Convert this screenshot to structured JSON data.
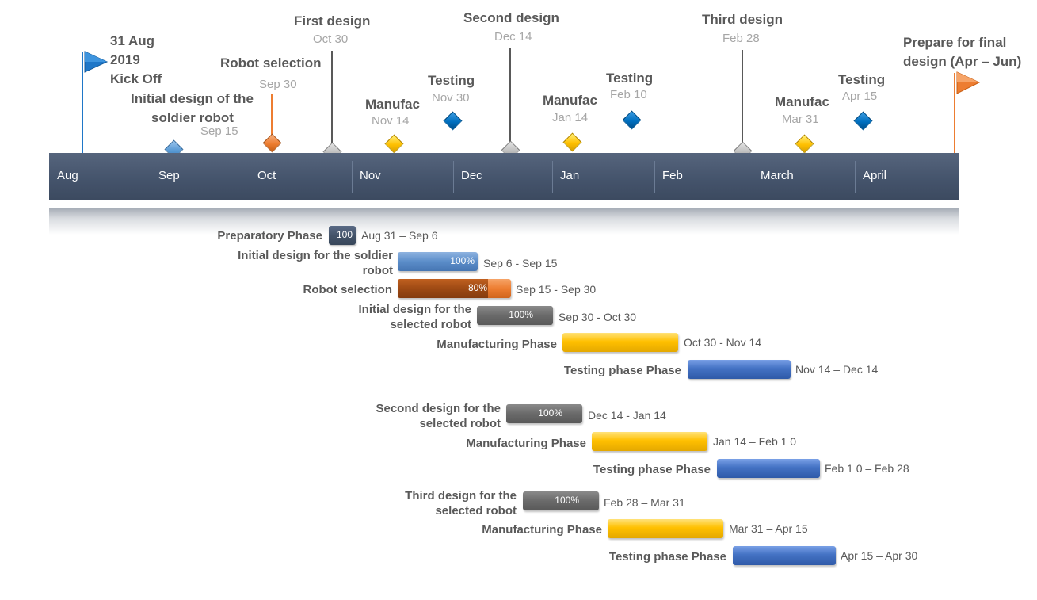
{
  "colors": {
    "axis": "#44546a",
    "flag_blue": "#1f77c8",
    "flag_orange": "#ed7d31",
    "diamond_grey": "#bfbfbf",
    "diamond_gold": "#ffc000",
    "diamond_blue": "#0070c0",
    "diamond_light_blue": "#5b9bd5",
    "diamond_orange": "#ed7d31",
    "bar_gold": "#ffc000",
    "bar_blue": "#4472c4",
    "bar_grey": "#6a6a6a",
    "bar_light_blue": "#5b8dc9",
    "bar_orange": "#ed7d31",
    "bar_brown": "#9e4a14",
    "bar_navy": "#44546a"
  },
  "timeline": {
    "months": [
      "Aug",
      "Sep",
      "Oct",
      "Nov",
      "Dec",
      "Jan",
      "Feb",
      "March",
      "April"
    ],
    "kickoff": {
      "line1": "31 Aug",
      "line2": "2019",
      "line3": "Kick Off"
    },
    "final": {
      "line1": "Prepare for final",
      "line2": "design (Apr – Jun)"
    },
    "milestones": [
      {
        "title": "Initial design of the soldier robot",
        "line1": "Initial design of the",
        "line2": "soldier robot",
        "date": "Sep 15",
        "icon": "diamond-light-blue"
      },
      {
        "title": "Robot selection",
        "date": "Sep 30",
        "icon": "diamond-orange"
      },
      {
        "title": "First design",
        "date": "Oct 30",
        "icon": "diamond-grey"
      },
      {
        "title": "Manufac",
        "date": "Nov 14",
        "icon": "diamond-gold"
      },
      {
        "title": "Testing",
        "date": "Nov 30",
        "icon": "diamond-blue"
      },
      {
        "title": "Second design",
        "date": "Dec 14",
        "icon": "diamond-grey"
      },
      {
        "title": "Manufac",
        "date": "Jan 14",
        "icon": "diamond-gold"
      },
      {
        "title": "Testing",
        "date": "Feb 10",
        "icon": "diamond-blue"
      },
      {
        "title": "Third design",
        "date": "Feb 28",
        "icon": "diamond-grey"
      },
      {
        "title": "Manufac",
        "date": "Mar 31",
        "icon": "diamond-gold"
      },
      {
        "title": "Testing",
        "date": "Apr 15",
        "icon": "diamond-blue"
      }
    ]
  },
  "tasks": [
    {
      "label": "Preparatory Phase",
      "percent": "100",
      "percent_complete": 1.0,
      "range": "Aug 31 – Sep 6",
      "color": "navy"
    },
    {
      "label": "Initial design for the soldier robot",
      "label1": "Initial design for the soldier",
      "label2": "robot",
      "percent": "100%",
      "percent_complete": 1.0,
      "range": "Sep 6 - Sep 15",
      "color": "light-blue"
    },
    {
      "label": "Robot selection",
      "percent": "80%",
      "percent_complete": 0.8,
      "range": "Sep 15 - Sep 30",
      "color": "orange"
    },
    {
      "label": "Initial design for the selected robot",
      "label1": "Initial design for the",
      "label2": "selected robot",
      "percent": "100%",
      "percent_complete": 1.0,
      "range": "Sep 30 - Oct 30",
      "color": "grey"
    },
    {
      "label": "Manufacturing Phase",
      "percent": "",
      "range": "Oct 30 - Nov 14",
      "color": "gold"
    },
    {
      "label": "Testing phase Phase",
      "percent": "",
      "range": "Nov 14 – Dec 14",
      "color": "blue"
    },
    {
      "label": "Second design for the selected robot",
      "label1": "Second design for the",
      "label2": "selected robot",
      "percent": "100%",
      "percent_complete": 1.0,
      "range": "Dec 14 - Jan 14",
      "color": "grey"
    },
    {
      "label": "Manufacturing Phase",
      "percent": "",
      "range": "Jan 14 – Feb 1 0",
      "color": "gold"
    },
    {
      "label": "Testing phase Phase",
      "percent": "",
      "range": "Feb 1 0 – Feb 28",
      "color": "blue"
    },
    {
      "label": "Third design for the selected robot",
      "label1": "Third design for the",
      "label2": "selected robot",
      "percent": "100%",
      "percent_complete": 1.0,
      "range": "Feb 28 – Mar 31",
      "color": "grey"
    },
    {
      "label": "Manufacturing Phase",
      "percent": "",
      "range": "Mar 31 – Apr 15",
      "color": "gold"
    },
    {
      "label": "Testing phase Phase",
      "percent": "",
      "range": "Apr 15  – Apr 30",
      "color": "blue"
    }
  ]
}
